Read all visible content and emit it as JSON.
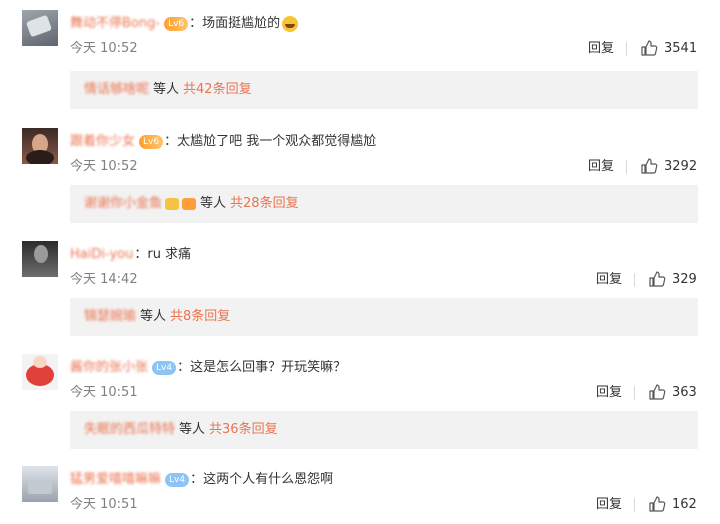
{
  "comments": [
    {
      "username": "舞动不停Bong-",
      "badge": "Lv6",
      "badge_type": "gold",
      "text": "场面挺尴尬的",
      "has_emoji": true,
      "emoji_icon": "laughing-crying-emoji-icon",
      "time": "今天 10:52",
      "reply_label": "回复",
      "likes": "3541",
      "sub_reply_users": "情话够啥呢",
      "sub_reply_badges": [],
      "sub_reply_deng": "等人",
      "sub_reply_total": "共42条回复"
    },
    {
      "username": "跟着你少女",
      "badge": "Lv6",
      "badge_type": "gold",
      "text": "太尴尬了吧 我一个观众都觉得尴尬",
      "has_emoji": false,
      "time": "今天 10:52",
      "reply_label": "回复",
      "likes": "3292",
      "sub_reply_users": "谢谢你小金鱼",
      "sub_reply_badges": [
        "#f5c542",
        "#ff9d3c"
      ],
      "sub_reply_deng": "等人",
      "sub_reply_total": "共28条回复"
    },
    {
      "username": "HaiDi-you",
      "badge": "",
      "badge_type": "",
      "text": "ru 求痛",
      "has_emoji": false,
      "time": "今天 14:42",
      "reply_label": "回复",
      "likes": "329",
      "sub_reply_users": "锦瑟婉瑜",
      "sub_reply_badges": [],
      "sub_reply_deng": "等人",
      "sub_reply_total": "共8条回复"
    },
    {
      "username": "酱你的张小张",
      "badge": "Lv4",
      "badge_type": "blue",
      "text": "这是怎么回事？开玩笑嘛？",
      "has_emoji": false,
      "time": "今天 10:51",
      "reply_label": "回复",
      "likes": "363",
      "sub_reply_users": "失眠的西瓜特特",
      "sub_reply_badges": [],
      "sub_reply_deng": "等人",
      "sub_reply_total": "共36条回复"
    },
    {
      "username": "猛男爱嘻嘻嘛嘛",
      "badge": "Lv4",
      "badge_type": "blue",
      "text": "这两个人有什么恩怨啊",
      "has_emoji": false,
      "time": "今天 10:51",
      "reply_label": "回复",
      "likes": "162"
    }
  ],
  "icons": {
    "like": "thumbs-up-icon",
    "avatar": "avatar"
  },
  "colors": {
    "username": "#eb7350",
    "reply_total": "#eb7350",
    "time": "#808080",
    "reply_box_bg": "#f2f2f2"
  }
}
